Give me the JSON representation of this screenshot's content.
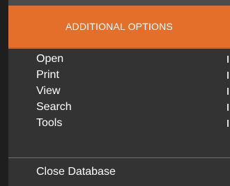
{
  "menu": {
    "header": "ADDITIONAL OPTIONS",
    "items": [
      {
        "label": "Open"
      },
      {
        "label": "Print"
      },
      {
        "label": "View"
      },
      {
        "label": "Search"
      },
      {
        "label": "Tools"
      }
    ],
    "close_label": "Close Database"
  },
  "colors": {
    "header_bg": "#e46f2b",
    "menu_bg": "#333333",
    "text": "#ffffff"
  }
}
